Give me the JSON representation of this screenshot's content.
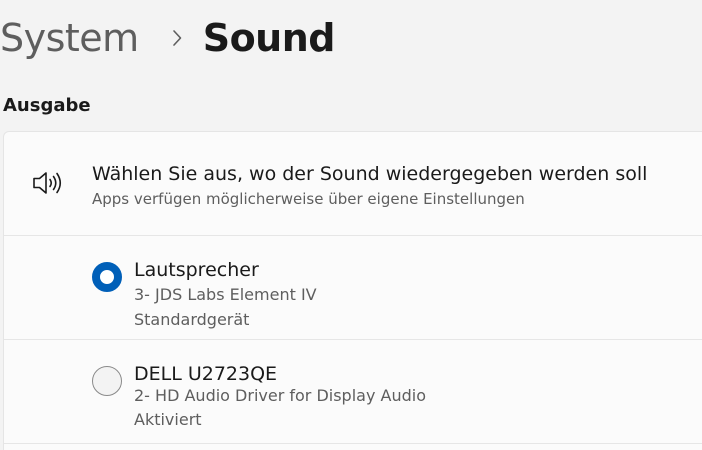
{
  "breadcrumb": {
    "parent": "System",
    "current": "Sound"
  },
  "section": {
    "title": "Ausgabe"
  },
  "output_card": {
    "title": "Wählen Sie aus, wo der Sound wiedergegeben werden soll",
    "subtitle": "Apps verfügen möglicherweise über eigene Einstellungen",
    "icon": "speaker-icon",
    "devices": [
      {
        "name": "Lautsprecher",
        "detail": "3- JDS Labs Element IV",
        "status": "Standardgerät",
        "selected": true
      },
      {
        "name": "DELL U2723QE",
        "detail": "2- HD Audio Driver for Display Audio",
        "status": "Aktiviert",
        "selected": false
      }
    ]
  },
  "colors": {
    "accent": "#005fb8",
    "background": "#f3f3f3",
    "card": "#fbfbfb",
    "secondary_text": "#5e5e5e"
  }
}
